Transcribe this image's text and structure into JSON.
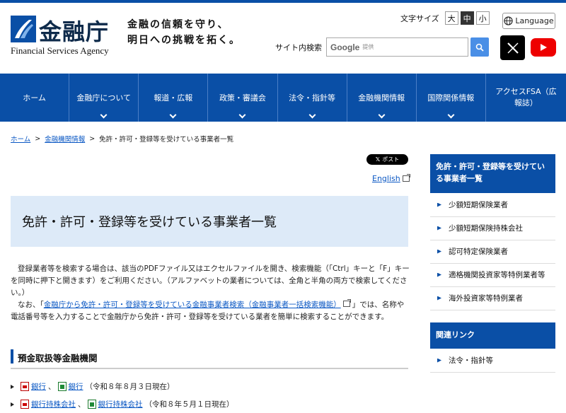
{
  "header": {
    "logo_name": "金融庁",
    "logo_en": "Financial Services Agency",
    "tagline_line1": "金融の信頼を守り、",
    "tagline_line2": "明日への挑戦を拓く。",
    "font_size_label": "文字サイズ",
    "font_size_options": [
      "大",
      "中",
      "小"
    ],
    "font_size_selected": "中",
    "language_label": "Language",
    "search_label": "サイト内検索",
    "search_google": "Google",
    "search_provided": "提供"
  },
  "nav": {
    "items": [
      {
        "label": "ホーム",
        "chevron": false
      },
      {
        "label": "金融庁について",
        "chevron": true
      },
      {
        "label": "報道・広報",
        "chevron": true
      },
      {
        "label": "政策・審議会",
        "chevron": true
      },
      {
        "label": "法令・指針等",
        "chevron": true
      },
      {
        "label": "金融機関情報",
        "chevron": true
      },
      {
        "label": "国際関係情報",
        "chevron": true
      },
      {
        "label": "アクセスFSA（広報誌）",
        "chevron": false
      }
    ]
  },
  "breadcrumb": {
    "home": "ホーム",
    "sep1": ">",
    "level2": "金融機関情報",
    "sep2": ">",
    "current": "免許・許可・登録等を受けている事業者一覧"
  },
  "main": {
    "post_label": "ポスト",
    "english_label": "English",
    "title": "免許・許可・登録等を受けている事業者一覧",
    "intro_p1": "登録業者等を検索する場合は、該当のPDFファイル又はエクセルファイルを開き、検索機能（「Ctrl」キーと「F」キーを同時に押下と開きます）をご利用ください。（アルファベットの業者については、全角と半角の両方で検索してください。）",
    "intro_p2_before": "なお、「",
    "intro_p2_link": "金融庁から免許・許可・登録等を受けている金融事業者検索（金融事業者一括検索機能）",
    "intro_p2_after": "」では、名称や電話番号等を入力することで金融庁から免許・許可・登録等を受けている業者を簡単に検索することができます。",
    "section_title": "預金取扱等金融機関",
    "entries": [
      {
        "pdf": "銀行",
        "sep": "、",
        "xls": "銀行",
        "date": "（令和８年８月３日現在）"
      },
      {
        "pdf": "銀行持株会社",
        "sep": "、",
        "xls": "銀行持株会社",
        "date": "（令和８年５月１日現在）"
      }
    ]
  },
  "sidebar": {
    "current_heading": "免許・許可・登録等を受けている事業者一覧",
    "items": [
      "少額短期保険業者",
      "少額短期保険持株会社",
      "認可特定保険業者",
      "適格機関投資家等特例業者等",
      "海外投資家等特例業者"
    ],
    "related_heading": "関連リンク",
    "related_items": [
      "法令・指針等"
    ]
  },
  "colors": {
    "brand_blue": "#0a4fa6",
    "title_bg": "#ddeaf8",
    "link": "#0b58c4"
  }
}
